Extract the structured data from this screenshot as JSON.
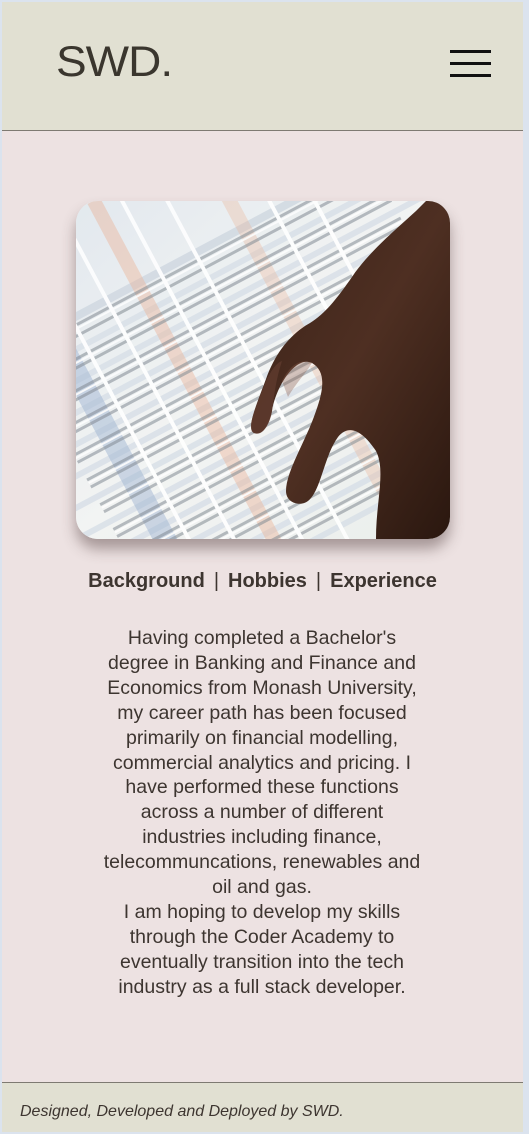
{
  "header": {
    "logo": "SWD.",
    "menu_icon": "hamburger-menu-icon"
  },
  "hero": {
    "image_description": "hand-pointing-at-spreadsheet-image"
  },
  "tabs": [
    {
      "label": "Background"
    },
    {
      "label": "Hobbies"
    },
    {
      "label": "Experience"
    }
  ],
  "tab_separator": "|",
  "bio": {
    "paragraph1": "Having completed a Bachelor's degree in Banking and Finance and Economics from Monash University, my career path has been focused primarily on financial modelling, commercial analytics and pricing. I have performed these functions across a number of different industries including finance, telecommuncations, renewables and oil and gas.",
    "paragraph2": "I am hoping to develop my skills through the Coder Academy to eventually transition into the tech industry as a full stack developer."
  },
  "footer": {
    "text": "Designed, Developed and Deployed by SWD."
  },
  "colors": {
    "page_background": "#ede2e2",
    "header_background": "#e1e0d2",
    "text": "#3d3530"
  }
}
